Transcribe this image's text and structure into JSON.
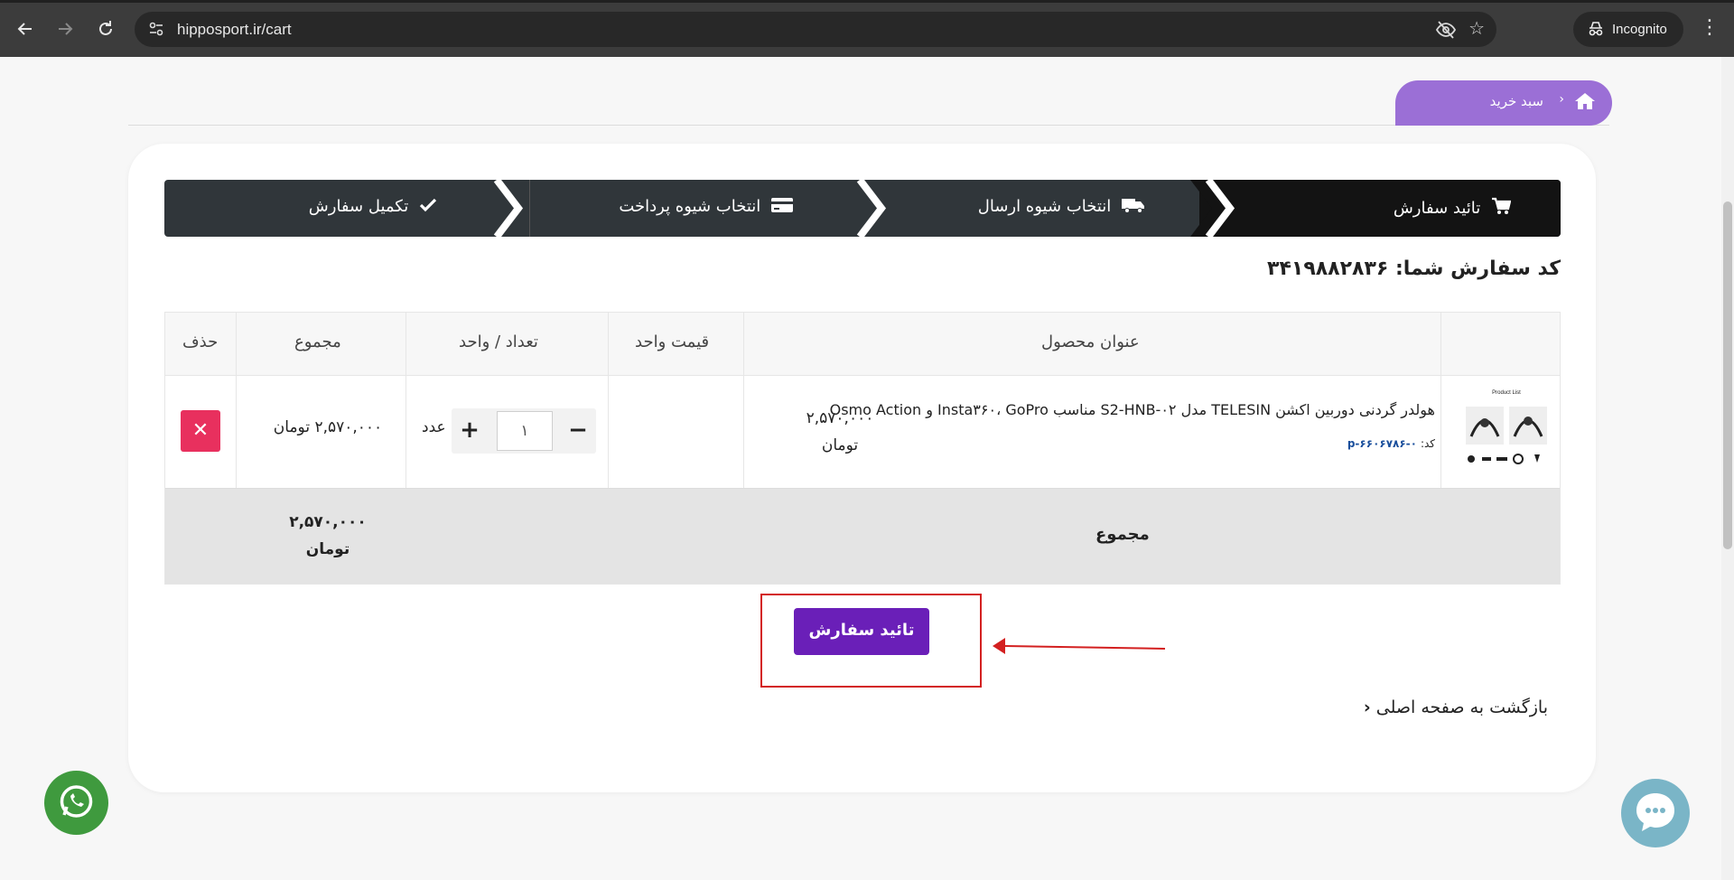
{
  "browser": {
    "url": "hipposport.ir/cart",
    "incognito_label": "Incognito",
    "icons": [
      "back-arrow-icon",
      "forward-arrow-icon",
      "reload-icon",
      "site-settings-icon",
      "eye-off-icon",
      "star-icon",
      "incognito-icon",
      "kebab-menu-icon"
    ]
  },
  "breadcrumb": {
    "current": "سبد خرید",
    "separator": "›"
  },
  "steps": [
    {
      "label": "تائید سفارش",
      "icon": "cart-icon",
      "active": true
    },
    {
      "label": "انتخاب شیوه ارسال",
      "icon": "truck-icon",
      "active": false
    },
    {
      "label": "انتخاب شیوه پرداخت",
      "icon": "credit-card-icon",
      "active": false
    },
    {
      "label": "تکمیل سفارش",
      "icon": "check-icon",
      "active": false
    }
  ],
  "order": {
    "code_label": "کد سفارش شما: ۳۴۱۹۸۸۲۸۳۶"
  },
  "table": {
    "headers": {
      "title": "عنوان محصول",
      "unit_price": "قیمت واحد",
      "quantity": "تعداد / واحد",
      "total": "مجموع",
      "delete": "حذف"
    },
    "rows": [
      {
        "title": "هولدر گردنی دوربین اکشن TELESIN مدل S2-HNB-۰۲ مناسب Insta۳۶۰، GoPro و Osmo Action",
        "code_label": "کد:",
        "code": "p-۶۶۰۶۷۸۶-۰",
        "image_caption": "Product List",
        "price_amount": "۲,۵۷۰,۰۰۰",
        "price_currency": "تومان",
        "quantity": "۱",
        "unit": "عدد",
        "total": "۲,۵۷۰,۰۰۰ تومان",
        "delete_symbol": "✕"
      }
    ],
    "footer": {
      "label": "مجموع",
      "total_amount": "۲,۵۷۰,۰۰۰",
      "total_currency": "تومان"
    }
  },
  "actions": {
    "confirm_label": "تائید سفارش",
    "back_label": "بازگشت به صفحه اصلی"
  },
  "colors": {
    "accent_purple": "#6a1fb8",
    "breadcrumb_purple": "#9b6fd6",
    "delete_red": "#e8305e",
    "steps_dark": "#30363a",
    "highlight_red": "#d32020",
    "whatsapp_green": "#3f9a3e",
    "chat_teal": "#7ab5c7"
  }
}
